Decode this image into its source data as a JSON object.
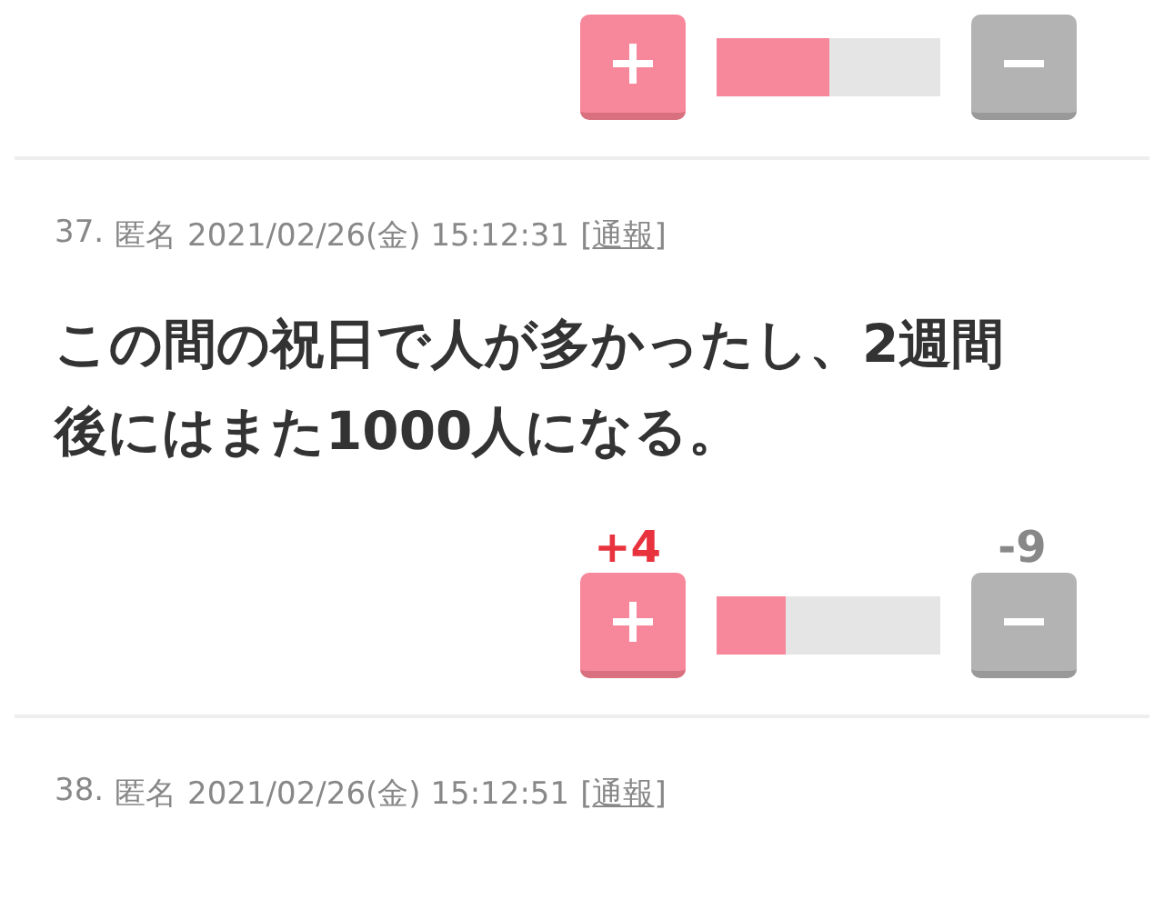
{
  "previous_votes": {
    "level": 0.5
  },
  "comments": [
    {
      "number": "37.",
      "author": "匿名",
      "date": "2021/02/26(金) 15:12:31",
      "report": {
        "open": "[",
        "label": "通報",
        "close": "]"
      },
      "body": "この間の祝日で人が多かったし、2週間後にはまた1000人になる。",
      "votes": {
        "plus": "+4",
        "minus": "-9",
        "level": 0.31
      }
    },
    {
      "number": "38.",
      "author": "匿名",
      "date": "2021/02/26(金) 15:12:51",
      "report": {
        "open": "[",
        "label": "通報",
        "close": "]"
      }
    }
  ]
}
